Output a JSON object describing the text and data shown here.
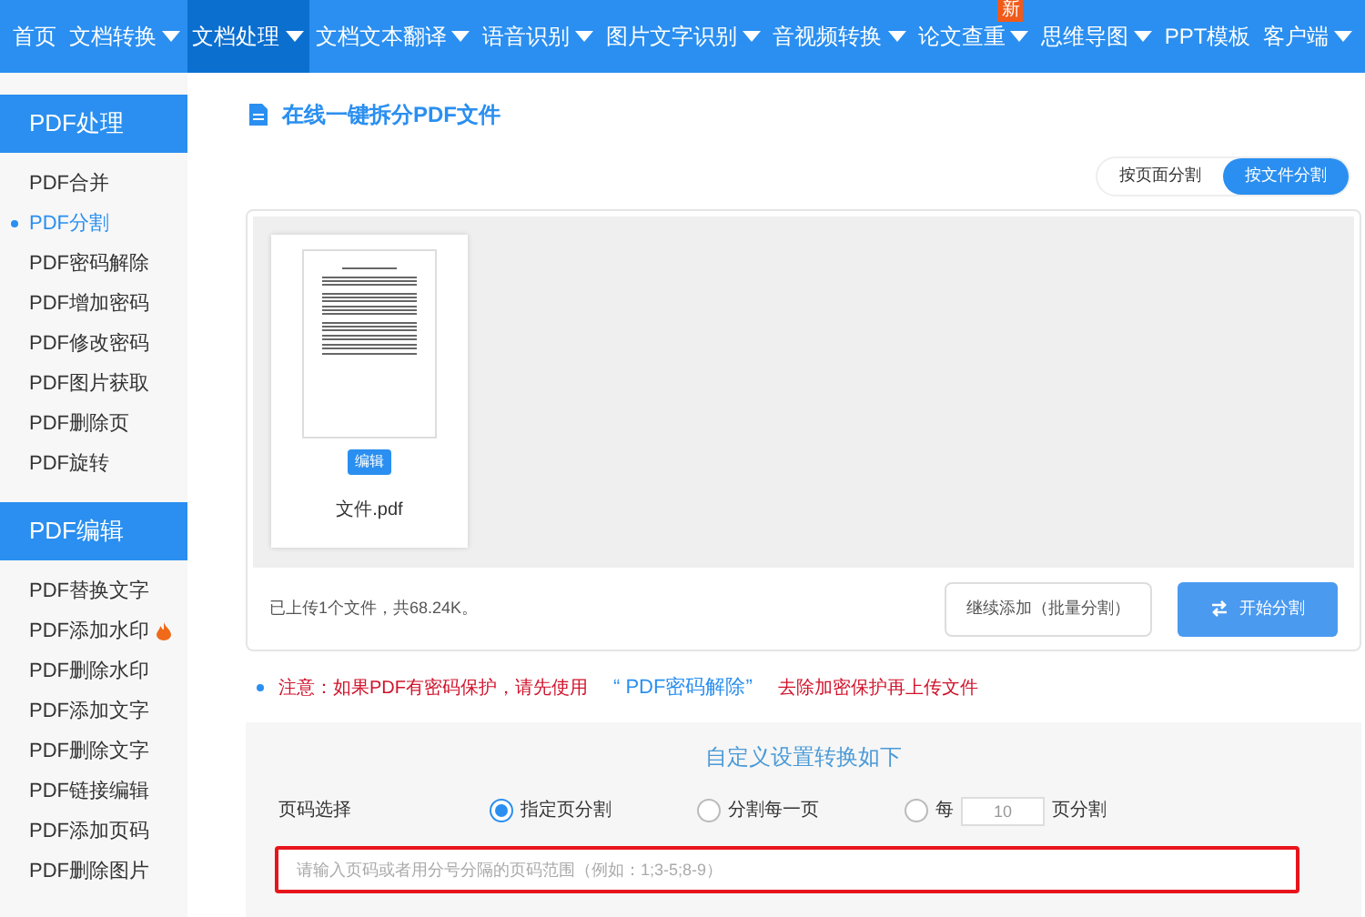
{
  "nav": [
    {
      "label": "首页",
      "dropdown": false,
      "selected": false
    },
    {
      "label": "文档转换",
      "dropdown": true,
      "selected": false
    },
    {
      "label": "文档处理",
      "dropdown": true,
      "selected": true
    },
    {
      "label": "文档文本翻译",
      "dropdown": true,
      "selected": false
    },
    {
      "label": "语音识别",
      "dropdown": true,
      "selected": false
    },
    {
      "label": "图片文字识别",
      "dropdown": true,
      "selected": false
    },
    {
      "label": "音视频转换",
      "dropdown": true,
      "selected": false
    },
    {
      "label": "论文查重",
      "dropdown": true,
      "selected": false,
      "badge": "新"
    },
    {
      "label": "思维导图",
      "dropdown": true,
      "selected": false
    },
    {
      "label": "PPT模板",
      "dropdown": false,
      "selected": false
    },
    {
      "label": "客户端",
      "dropdown": true,
      "selected": false
    }
  ],
  "sidebar": [
    {
      "title": "PDF处理",
      "items": [
        {
          "label": "PDF合并",
          "selected": false,
          "hot": false
        },
        {
          "label": "PDF分割",
          "selected": true,
          "hot": false
        },
        {
          "label": "PDF密码解除",
          "selected": false,
          "hot": false
        },
        {
          "label": "PDF增加密码",
          "selected": false,
          "hot": false
        },
        {
          "label": "PDF修改密码",
          "selected": false,
          "hot": false
        },
        {
          "label": "PDF图片获取",
          "selected": false,
          "hot": false
        },
        {
          "label": "PDF删除页",
          "selected": false,
          "hot": false
        },
        {
          "label": "PDF旋转",
          "selected": false,
          "hot": false
        }
      ]
    },
    {
      "title": "PDF编辑",
      "items": [
        {
          "label": "PDF替换文字",
          "selected": false,
          "hot": false
        },
        {
          "label": "PDF添加水印",
          "selected": false,
          "hot": true
        },
        {
          "label": "PDF删除水印",
          "selected": false,
          "hot": false
        },
        {
          "label": "PDF添加文字",
          "selected": false,
          "hot": false
        },
        {
          "label": "PDF删除文字",
          "selected": false,
          "hot": false
        },
        {
          "label": "PDF链接编辑",
          "selected": false,
          "hot": false
        },
        {
          "label": "PDF添加页码",
          "selected": false,
          "hot": false
        },
        {
          "label": "PDF删除图片",
          "selected": false,
          "hot": false
        }
      ]
    }
  ],
  "page_title": "在线一键拆分PDF文件",
  "mode_tabs": [
    {
      "label": "按页面分割",
      "selected": false
    },
    {
      "label": "按文件分割",
      "selected": true
    }
  ],
  "files": [
    {
      "name": "文件.pdf",
      "edit_button": "编辑"
    }
  ],
  "upload_status": "已上传1个文件，共68.24K。",
  "add_button": "继续添加（批量分割）",
  "start_button": "开始分割",
  "notice": {
    "before": "注意：如果PDF有密码保护，请先使用",
    "link": "“ PDF密码解除”",
    "after": "去除加密保护再上传文件"
  },
  "settings": {
    "heading": "自定义设置转换如下",
    "label": "页码选择",
    "options": [
      {
        "kind": "plain",
        "label": "指定页分割",
        "selected": true
      },
      {
        "kind": "plain",
        "label": "分割每一页",
        "selected": false
      },
      {
        "kind": "every",
        "prefix": "每",
        "value": "10",
        "suffix": "页分割",
        "selected": false
      }
    ],
    "range_input": {
      "placeholder": "请输入页码或者用分号分隔的页码范围（例如：1;3-5;8-9）"
    }
  }
}
